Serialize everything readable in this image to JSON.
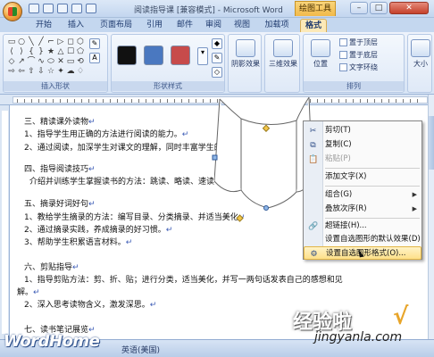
{
  "title_bar": {
    "doc_title": "阅读指导课 [兼容模式] - Microsoft Word",
    "context_tool": "绘图工具",
    "minimize": "–",
    "maximize": "□",
    "close": "✕"
  },
  "tabs": [
    "开始",
    "插入",
    "页面布局",
    "引用",
    "邮件",
    "审阅",
    "视图",
    "加载项",
    "格式"
  ],
  "ribbon": {
    "insert_shapes_label": "插入形状",
    "shape_glyphs": [
      "▭",
      "○",
      "╲",
      "╱",
      "⌐",
      "▷",
      "◻",
      "⬡",
      "⟨",
      "⟩",
      "{",
      "}",
      "★",
      "△",
      "☐",
      "⬠",
      "◇",
      "↗",
      "⌒",
      "∿",
      "⬭",
      "✕",
      "▭",
      "⟲",
      "⇨",
      "⇦",
      "⇧",
      "⇩",
      "☆",
      "✦",
      "☁",
      "♢"
    ],
    "shape_styles_label": "形状样式",
    "swatch_colors": [
      "#111111",
      "#4a78c0",
      "#c74b4b"
    ],
    "shadow_effects_label": "阴影效果",
    "three_d_effects_label": "三维效果",
    "arrange_label": "排列",
    "position_label": "位置",
    "bring_to_front": "置于顶层",
    "send_to_back": "置于底层",
    "text_wrapping": "文字环绕",
    "size_label": "大小"
  },
  "document": {
    "lines": [
      "三、精读课外读物",
      "1、指导学生用正确的方法进行阅读的能力。",
      "2、通过阅读，加深学生对课文的理解，同时丰富学生的",
      "四、指导阅读技巧",
      "介绍并训练学生掌握读书的方法：跳读、略读、速读",
      "五、摘录好词好句",
      "1、教给学生摘录的方法：编写目录、分类摘录、并适当美化",
      "2、通过摘录实践，养成摘录的好习惯。",
      "3、帮助学生积累语言材料。",
      "六、剪贴指导",
      "1、指导剪贴方法：剪、折、贴；进行分类，适当美化，并写一两句话发表自己的感想和见",
      "解。",
      "2、深入思考读物含义，激发深思。",
      "七、读书笔记展览"
    ],
    "para_mark": "↵"
  },
  "context_menu": {
    "items": [
      {
        "label": "剪切(T)",
        "icon": "✂",
        "disabled": false
      },
      {
        "label": "复制(C)",
        "icon": "⧉",
        "disabled": false
      },
      {
        "label": "粘贴(P)",
        "icon": "📋",
        "disabled": true
      },
      {
        "label": "添加文字(X)",
        "icon": "",
        "disabled": false
      },
      {
        "label": "组合(G)",
        "icon": "",
        "disabled": false,
        "submenu": true
      },
      {
        "label": "叠放次序(R)",
        "icon": "",
        "disabled": false,
        "submenu": true
      },
      {
        "label": "超链接(H)...",
        "icon": "🔗",
        "disabled": false
      },
      {
        "label": "设置自选图形的默认效果(D)",
        "icon": "",
        "disabled": false
      },
      {
        "label": "设置自选图形格式(O)...",
        "icon": "⚙",
        "disabled": false,
        "highlight": true
      }
    ]
  },
  "status_bar": {
    "language": "英语(美国)"
  },
  "watermarks": {
    "brand": "WordHome",
    "site_cn": "经验啦",
    "check": "√",
    "url": "jingyanla.com"
  }
}
